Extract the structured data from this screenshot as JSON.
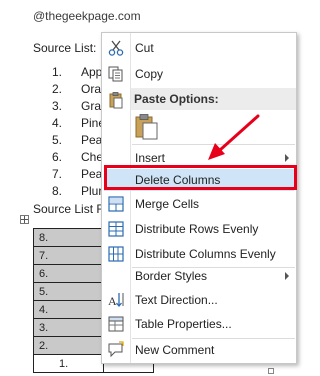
{
  "watermark": "@thegeekpage.com",
  "document": {
    "source_label": "Source List:",
    "list": [
      {
        "num": "1.",
        "text": "App"
      },
      {
        "num": "2.",
        "text": "Ora"
      },
      {
        "num": "3.",
        "text": "Gra"
      },
      {
        "num": "4.",
        "text": "Pine"
      },
      {
        "num": "5.",
        "text": "Pea"
      },
      {
        "num": "6.",
        "text": "Che"
      },
      {
        "num": "7.",
        "text": "Pea"
      },
      {
        "num": "8.",
        "text": "Plur"
      }
    ],
    "source_label2": "Source List Re",
    "table_rows": [
      "8.",
      "7.",
      "6.",
      "5.",
      "4.",
      "3.",
      "2.",
      "1."
    ]
  },
  "context_menu": {
    "cut": "Cut",
    "copy": "Copy",
    "paste_options": "Paste Options:",
    "insert": "Insert",
    "delete_columns": "Delete Columns",
    "merge_cells": "Merge Cells",
    "distribute_rows": "Distribute Rows Evenly",
    "distribute_columns": "Distribute Columns Evenly",
    "border_styles": "Border Styles",
    "text_direction": "Text Direction...",
    "table_properties": "Table Properties...",
    "new_comment": "New Comment"
  },
  "colors": {
    "highlight_row": "#cfe4f7",
    "annotation_red": "#e8001a",
    "selected_cells": "#c9c9c9"
  },
  "icons": [
    "scissors-icon",
    "copy-icon",
    "clipboard-icon",
    "merge-cells-icon",
    "distribute-rows-icon",
    "distribute-columns-icon",
    "text-direction-icon",
    "table-properties-icon",
    "new-comment-icon"
  ]
}
